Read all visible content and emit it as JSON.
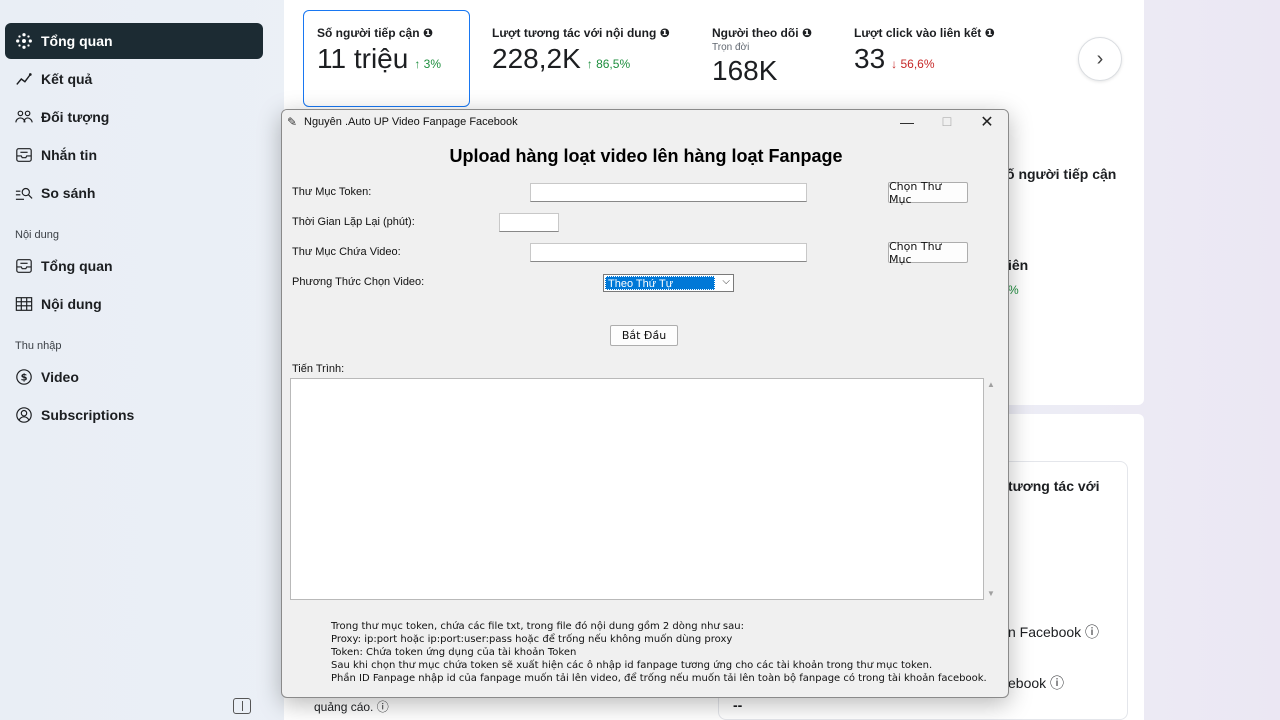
{
  "sidebar": {
    "items": [
      {
        "label": "Tổng quan",
        "icon": "sparkle-icon"
      },
      {
        "label": "Kết quả",
        "icon": "trend-icon"
      },
      {
        "label": "Đối tượng",
        "icon": "people-icon"
      },
      {
        "label": "Nhắn tin",
        "icon": "inbox-icon"
      },
      {
        "label": "So sánh",
        "icon": "compare-icon"
      }
    ],
    "section_content": "Nội dung",
    "content_items": [
      {
        "label": "Tổng quan",
        "icon": "inbox-icon"
      },
      {
        "label": "Nội dung",
        "icon": "table-icon"
      }
    ],
    "section_income": "Thu nhập",
    "income_items": [
      {
        "label": "Video",
        "icon": "dollar-icon"
      },
      {
        "label": "Subscriptions",
        "icon": "user-circle-icon"
      }
    ]
  },
  "metrics": [
    {
      "label": "Số người tiếp cận",
      "value": "11 triệu",
      "change": "↑ 3%",
      "direction": "up"
    },
    {
      "label": "Lượt tương tác với nội dung",
      "value": "228,2K",
      "change": "↑ 86,5%",
      "direction": "up"
    },
    {
      "label": "Người theo dõi",
      "sub": "Trọn đời",
      "value": "168K"
    },
    {
      "label": "Lượt click vào liên kết",
      "value": "33",
      "change": "↓ 56,6%",
      "direction": "down"
    }
  ],
  "peek": {
    "reach": "ố người tiếp cận",
    "fan": "iên",
    "pct": "%",
    "interact": "tương tác với",
    "facebook1": "n Facebook ⓘ",
    "facebook2": "ebook ⓘ",
    "ads": "quảng cáo. ⓘ",
    "dash": "--"
  },
  "window": {
    "title": "Nguyên .Auto UP Video Fanpage Facebook",
    "heading": "Upload hàng loạt video lên hàng loạt Fanpage",
    "token_label": "Thư Mục Token:",
    "token_value": "",
    "repeat_label": "Thời Gian Lặp Lại (phút):",
    "repeat_value": "",
    "video_label": "Thư Mục Chứa Video:",
    "video_value": "",
    "method_label": "Phương Thức Chọn Video:",
    "method_value": "Theo Thứ Tự",
    "choose_folder": "Chọn Thư Mục",
    "start": "Bắt Đầu",
    "progress_label": "Tiến Trình:",
    "progress_text": "",
    "notes": [
      "Trong thư mục token, chứa các file txt, trong file đó nội dung gồm 2 dòng như sau:",
      "Proxy: ip:port hoặc ip:port:user:pass hoặc để trống nếu không muốn dùng proxy",
      "Token: Chứa token ứng dụng của tài khoản Token",
      "Sau khi chọn thư mục chứa token sẽ xuất hiện các ô nhập id fanpage tương ứng cho các tài khoản trong thư mục token.",
      "Phần ID Fanpage nhập id của fanpage muốn tải lên video, để trống nếu muốn tải lên toàn bộ fanpage có trong tài khoản facebook."
    ]
  }
}
